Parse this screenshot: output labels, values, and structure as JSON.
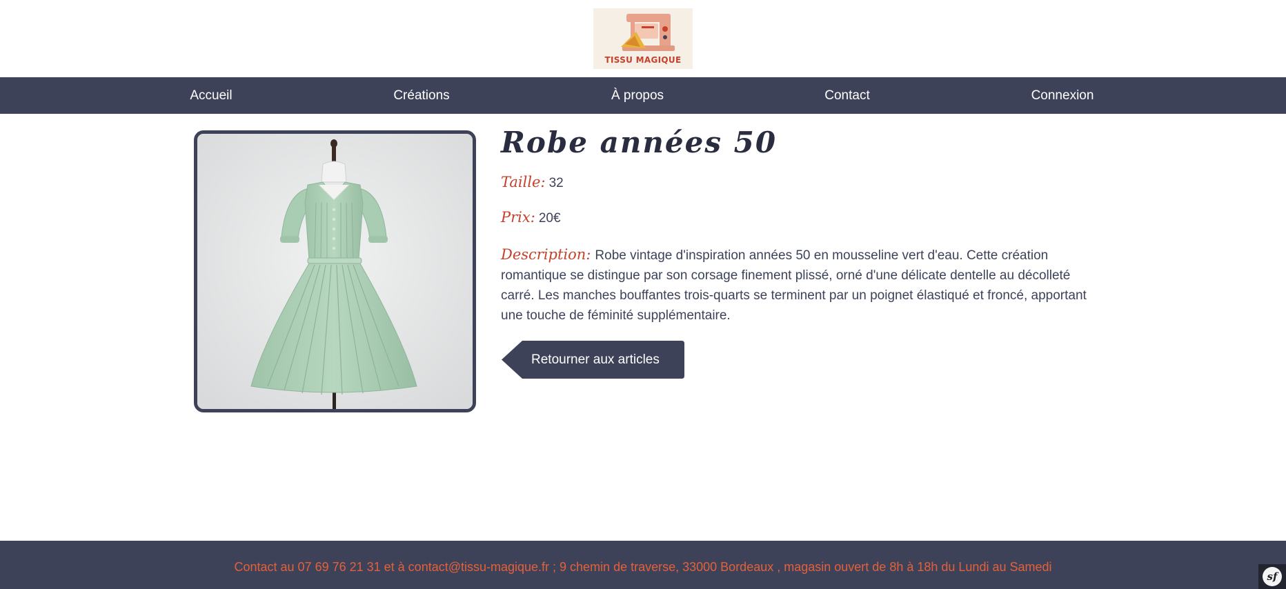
{
  "brand": {
    "logo_text": "TISSU MAGIQUE",
    "logo_icon": "sewing-machine-icon"
  },
  "nav": {
    "items": [
      {
        "label": "Accueil"
      },
      {
        "label": "Créations"
      },
      {
        "label": "À propos"
      },
      {
        "label": "Contact"
      },
      {
        "label": "Connexion"
      }
    ]
  },
  "product": {
    "title": "Robe années 50",
    "size_label": "Taille:",
    "size_value": "32",
    "price_label": "Prix:",
    "price_value": "20€",
    "description_label": "Description:",
    "description_text": "Robe vintage d'inspiration années 50 en mousseline vert d'eau. Cette création romantique se distingue par son corsage finement plissé, orné d'une délicate dentelle au décolleté carré. Les manches bouffantes trois-quarts se terminent par un poignet élastiqué et froncé, apportant une touche de féminité supplémentaire.",
    "back_button_label": "Retourner aux articles"
  },
  "footer": {
    "text": "Contact au 07 69 76 21 31 et à contact@tissu-magique.fr ; 9 chemin de traverse, 33000 Bordeaux , magasin ouvert de 8h à 18h du Lundi au Samedi"
  },
  "debug_toolbar": {
    "icon": "symfony-icon"
  },
  "colors": {
    "nav_bg": "#3e4259",
    "accent": "#c6402b",
    "footer_text": "#e2613b",
    "dress": "#a9cdb3"
  }
}
